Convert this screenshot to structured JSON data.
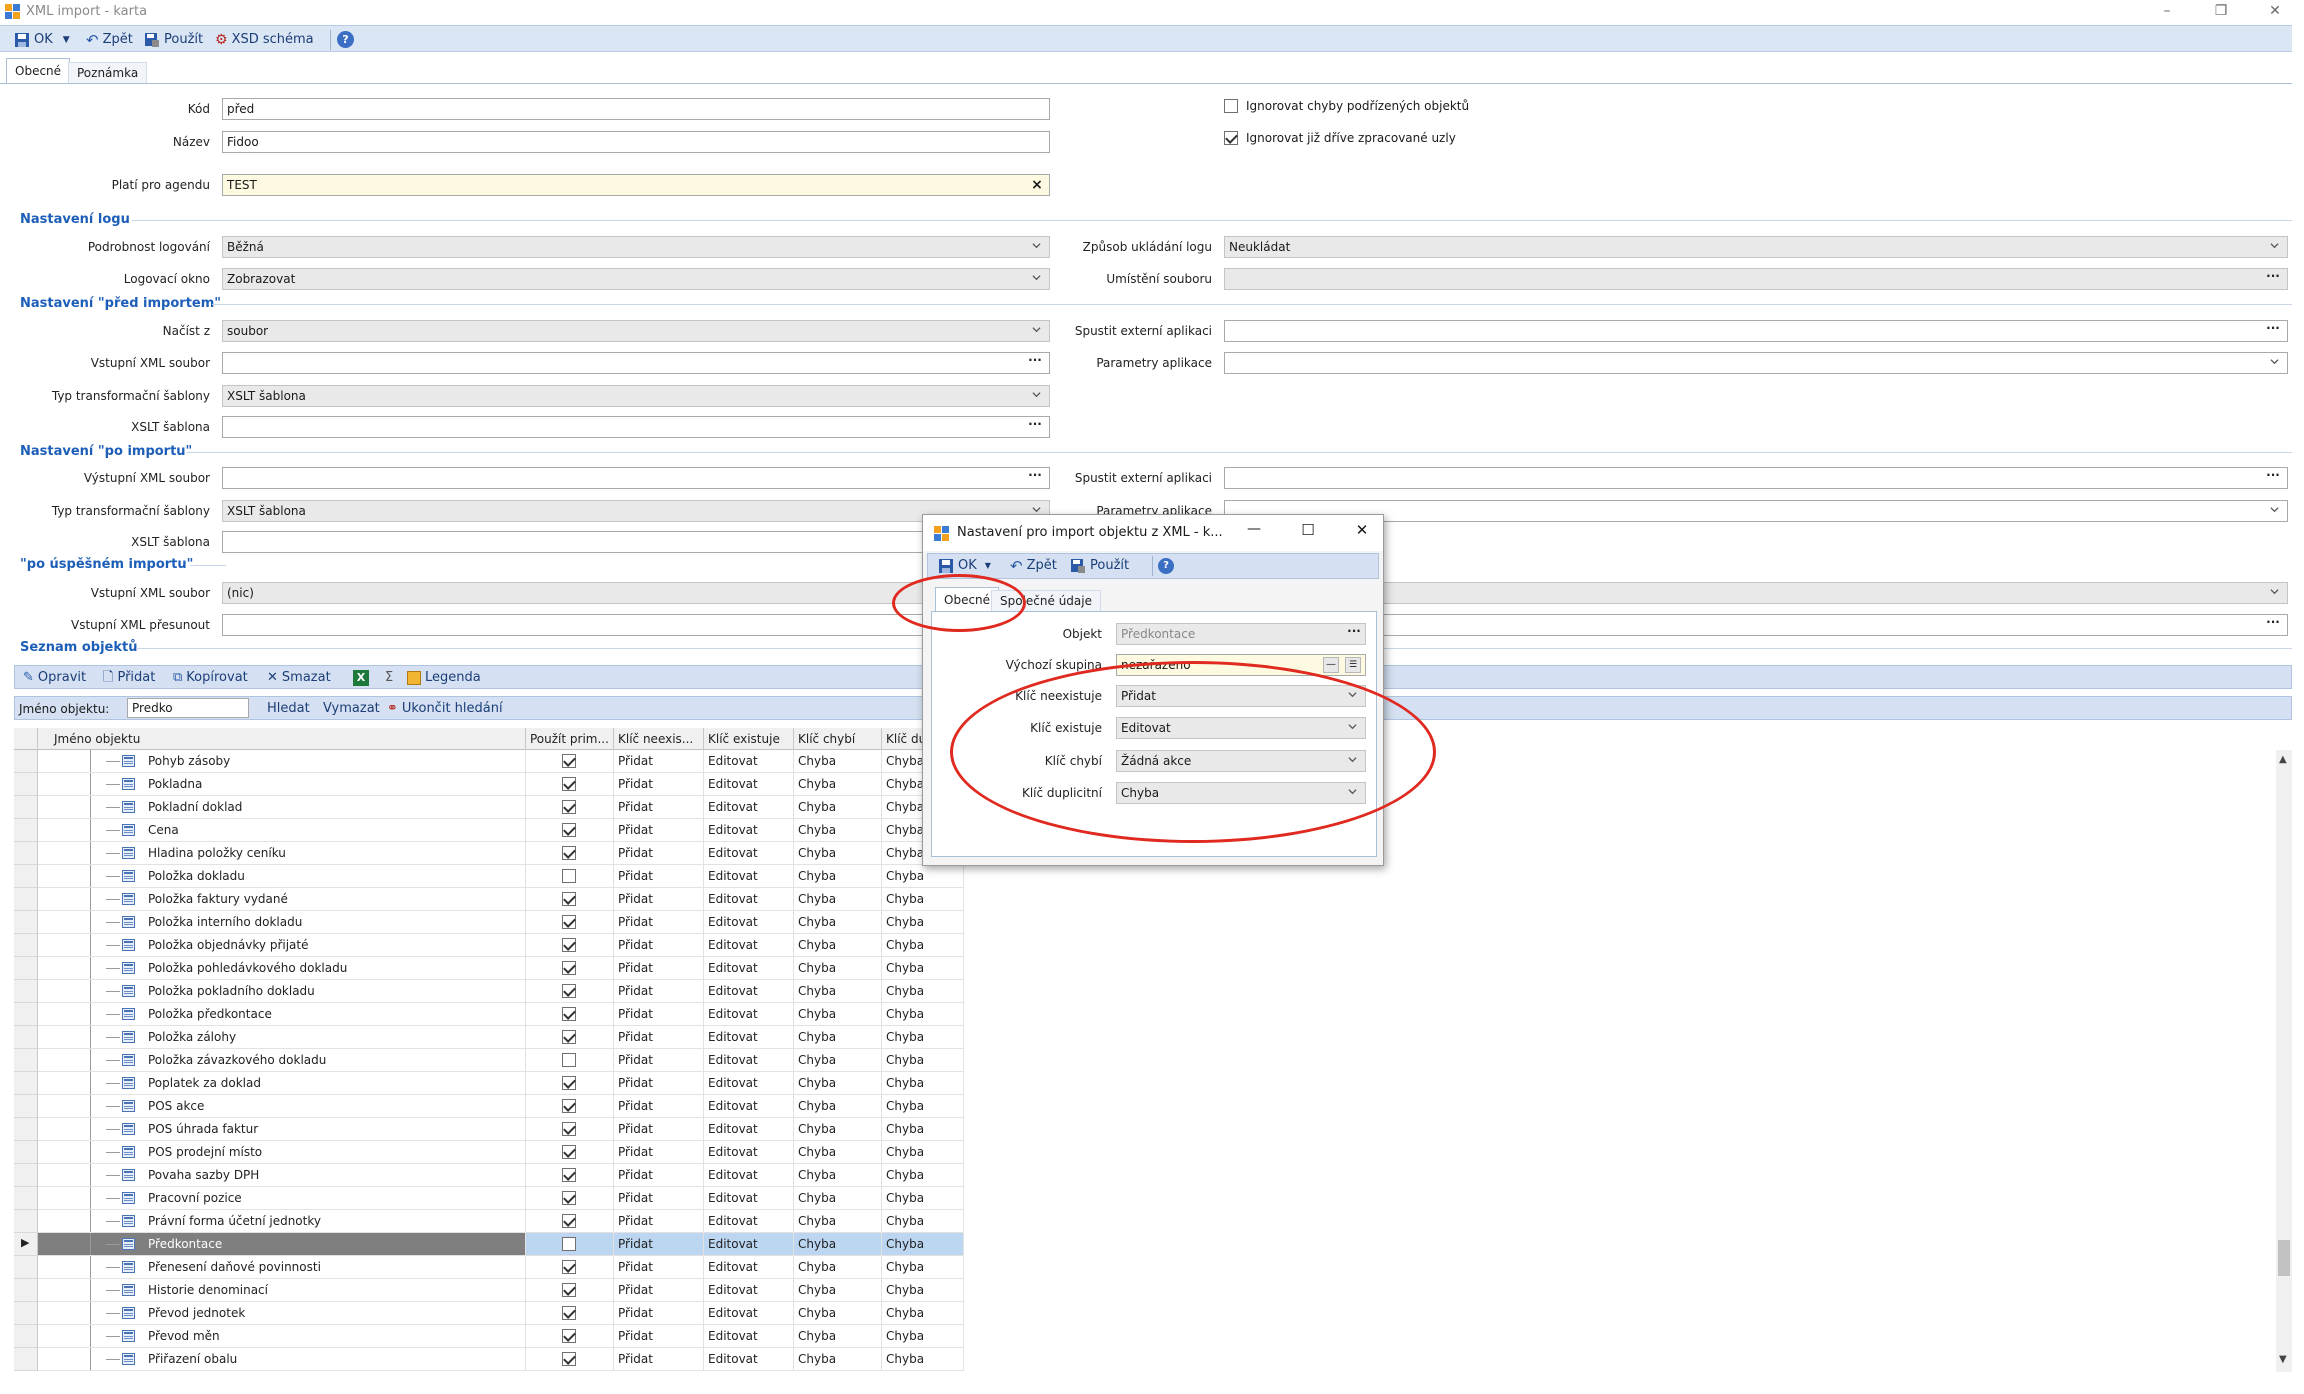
{
  "window": {
    "title": "XML import - karta",
    "minimize": "–",
    "restore": "❐",
    "close": "✕"
  },
  "toolbar": {
    "ok": "OK",
    "back": "Zpět",
    "apply": "Použít",
    "xsd": "XSD schéma"
  },
  "tabs": {
    "general": "Obecné",
    "note": "Poznámka"
  },
  "form": {
    "kod_label": "Kód",
    "kod_value": "před",
    "nazev_label": "Název",
    "nazev_value": "Fidoo",
    "agenda_label": "Platí pro agendu",
    "agenda_value": "TEST",
    "ignore_child_errors": "Ignorovat chyby podřízených objektů",
    "ignore_processed": "Ignorovat již dříve zpracované uzly"
  },
  "log_section": {
    "title": "Nastavení logu",
    "detail_label": "Podrobnost logování",
    "detail_value": "Běžná",
    "window_label": "Logovací okno",
    "window_value": "Zobrazovat",
    "save_label": "Způsob ukládání logu",
    "save_value": "Neukládat",
    "location_label": "Umístění souboru"
  },
  "before_section": {
    "title": "Nastavení \"před importem\"",
    "load_label": "Načíst z",
    "load_value": "soubor",
    "input_xml_label": "Vstupní XML soubor",
    "transform_label": "Typ transformační šablony",
    "transform_value": "XSLT šablona",
    "xslt_label": "XSLT šablona",
    "ext_app_label": "Spustit externí aplikaci",
    "app_params_label": "Parametry aplikace"
  },
  "after_section": {
    "title": "Nastavení \"po importu\"",
    "output_xml_label": "Výstupní XML soubor",
    "transform_label": "Typ transformační šablony",
    "transform_value": "XSLT šablona",
    "xslt_label": "XSLT šablona",
    "ext_app_label": "Spustit externí aplikaci",
    "app_params_label": "Parametry aplikace"
  },
  "success_section": {
    "title": "\"po úspěšném importu\"",
    "input_xml_label": "Vstupní XML soubor",
    "input_xml_value": "(nic)",
    "move_label": "Vstupní XML přesunout"
  },
  "objects_section": {
    "title": "Seznam objektů",
    "edit": "Opravit",
    "add": "Přidat",
    "copy": "Kopírovat",
    "delete": "Smazat",
    "sigma": "Σ",
    "legend": "Legenda",
    "filter_label": "Jméno objektu:",
    "filter_value": "Predko",
    "search": "Hledat",
    "clear": "Vymazat",
    "end_search": "Ukončit hledání"
  },
  "grid": {
    "columns": [
      "Jméno objektu",
      "Použít prim...",
      "Klíč neexis...",
      "Klíč existuje",
      "Klíč chybí",
      "Klíč dup"
    ],
    "rows": [
      {
        "name": "Pohyb zásoby",
        "checked": true,
        "c1": "Přidat",
        "c2": "Editovat",
        "c3": "Chyba",
        "c4": "Chyba"
      },
      {
        "name": "Pokladna",
        "checked": true,
        "c1": "Přidat",
        "c2": "Editovat",
        "c3": "Chyba",
        "c4": "Chyba"
      },
      {
        "name": "Pokladní doklad",
        "checked": true,
        "c1": "Přidat",
        "c2": "Editovat",
        "c3": "Chyba",
        "c4": "Chyba"
      },
      {
        "name": "Cena",
        "checked": true,
        "c1": "Přidat",
        "c2": "Editovat",
        "c3": "Chyba",
        "c4": "Chyba"
      },
      {
        "name": "Hladina položky ceníku",
        "checked": true,
        "c1": "Přidat",
        "c2": "Editovat",
        "c3": "Chyba",
        "c4": "Chyba"
      },
      {
        "name": "Položka dokladu",
        "checked": false,
        "c1": "Přidat",
        "c2": "Editovat",
        "c3": "Chyba",
        "c4": "Chyba"
      },
      {
        "name": "Položka faktury vydané",
        "checked": true,
        "c1": "Přidat",
        "c2": "Editovat",
        "c3": "Chyba",
        "c4": "Chyba"
      },
      {
        "name": "Položka interního dokladu",
        "checked": true,
        "c1": "Přidat",
        "c2": "Editovat",
        "c3": "Chyba",
        "c4": "Chyba"
      },
      {
        "name": "Položka objednávky přijaté",
        "checked": true,
        "c1": "Přidat",
        "c2": "Editovat",
        "c3": "Chyba",
        "c4": "Chyba"
      },
      {
        "name": "Položka pohledávkového dokladu",
        "checked": true,
        "c1": "Přidat",
        "c2": "Editovat",
        "c3": "Chyba",
        "c4": "Chyba"
      },
      {
        "name": "Položka pokladního dokladu",
        "checked": true,
        "c1": "Přidat",
        "c2": "Editovat",
        "c3": "Chyba",
        "c4": "Chyba"
      },
      {
        "name": "Položka předkontace",
        "checked": true,
        "c1": "Přidat",
        "c2": "Editovat",
        "c3": "Chyba",
        "c4": "Chyba"
      },
      {
        "name": "Položka zálohy",
        "checked": true,
        "c1": "Přidat",
        "c2": "Editovat",
        "c3": "Chyba",
        "c4": "Chyba"
      },
      {
        "name": "Položka závazkového dokladu",
        "checked": false,
        "c1": "Přidat",
        "c2": "Editovat",
        "c3": "Chyba",
        "c4": "Chyba"
      },
      {
        "name": "Poplatek za doklad",
        "checked": true,
        "c1": "Přidat",
        "c2": "Editovat",
        "c3": "Chyba",
        "c4": "Chyba"
      },
      {
        "name": "POS akce",
        "checked": true,
        "c1": "Přidat",
        "c2": "Editovat",
        "c3": "Chyba",
        "c4": "Chyba"
      },
      {
        "name": "POS úhrada faktur",
        "checked": true,
        "c1": "Přidat",
        "c2": "Editovat",
        "c3": "Chyba",
        "c4": "Chyba"
      },
      {
        "name": "POS prodejní místo",
        "checked": true,
        "c1": "Přidat",
        "c2": "Editovat",
        "c3": "Chyba",
        "c4": "Chyba"
      },
      {
        "name": "Povaha sazby DPH",
        "checked": true,
        "c1": "Přidat",
        "c2": "Editovat",
        "c3": "Chyba",
        "c4": "Chyba"
      },
      {
        "name": "Pracovní pozice",
        "checked": true,
        "c1": "Přidat",
        "c2": "Editovat",
        "c3": "Chyba",
        "c4": "Chyba"
      },
      {
        "name": "Právní forma účetní jednotky",
        "checked": true,
        "c1": "Přidat",
        "c2": "Editovat",
        "c3": "Chyba",
        "c4": "Chyba"
      },
      {
        "name": "Předkontace",
        "checked": false,
        "selected": true,
        "c1": "Přidat",
        "c2": "Editovat",
        "c3": "Chyba",
        "c4": "Chyba"
      },
      {
        "name": "Přenesení daňové povinnosti",
        "checked": true,
        "c1": "Přidat",
        "c2": "Editovat",
        "c3": "Chyba",
        "c4": "Chyba"
      },
      {
        "name": "Historie denominací",
        "checked": true,
        "c1": "Přidat",
        "c2": "Editovat",
        "c3": "Chyba",
        "c4": "Chyba"
      },
      {
        "name": "Převod jednotek",
        "checked": true,
        "c1": "Přidat",
        "c2": "Editovat",
        "c3": "Chyba",
        "c4": "Chyba"
      },
      {
        "name": "Převod měn",
        "checked": true,
        "c1": "Přidat",
        "c2": "Editovat",
        "c3": "Chyba",
        "c4": "Chyba"
      },
      {
        "name": "Přiřazení obalu",
        "checked": true,
        "c1": "Přidat",
        "c2": "Editovat",
        "c3": "Chyba",
        "c4": "Chyba"
      }
    ]
  },
  "dialog": {
    "title": "Nastavení pro import objektu z XML - k...",
    "minimize": "—",
    "maximize": "☐",
    "close": "✕",
    "ok": "OK",
    "back": "Zpět",
    "apply": "Použít",
    "tab_general": "Obecné",
    "tab_shared": "Společné údaje",
    "object_label": "Objekt",
    "object_value": "Předkontace",
    "group_label": "Výchozí skupina",
    "group_value": "nezařazeno",
    "key_missing_label": "Klíč neexistuje",
    "key_missing_value": "Přidat",
    "key_exists_label": "Klíč existuje",
    "key_exists_value": "Editovat",
    "key_absent_label": "Klíč chybí",
    "key_absent_value": "Žádná akce",
    "key_dup_label": "Klíč duplicitní",
    "key_dup_value": "Chyba"
  },
  "colors": {
    "accent": "#1d5fb8",
    "toolbar": "#dbe6f5",
    "highlight": "#e0291f",
    "selected_row": "#bcd6f2"
  }
}
